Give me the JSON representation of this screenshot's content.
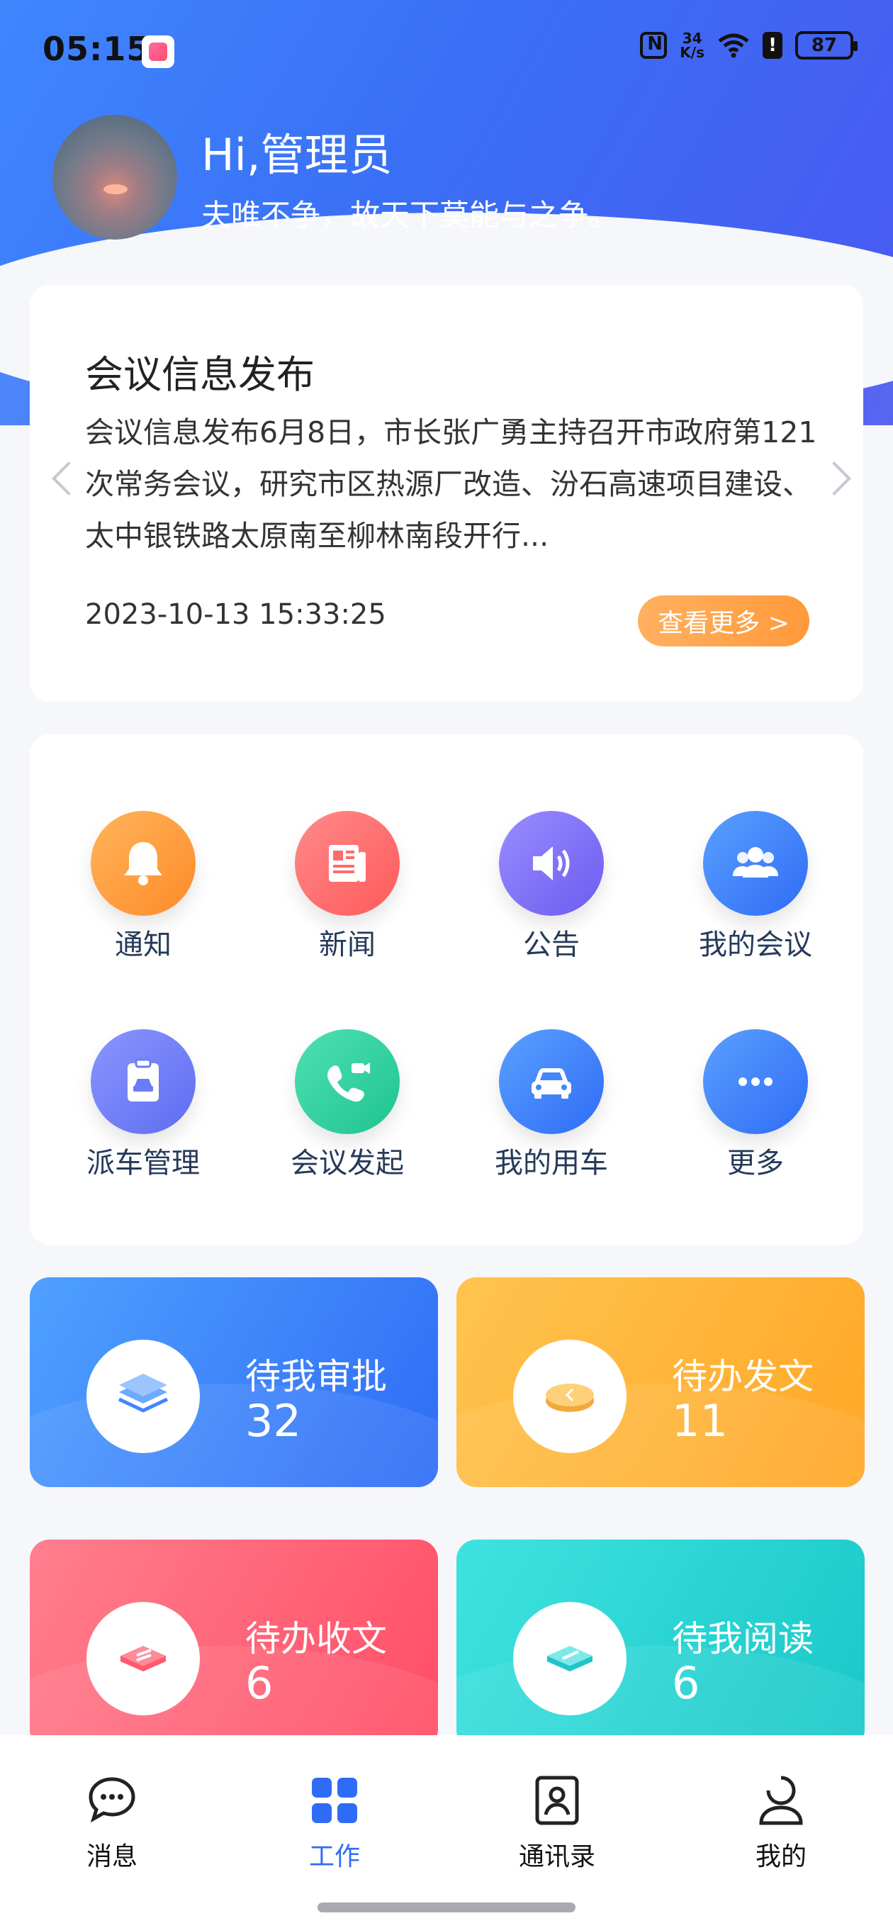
{
  "status_bar": {
    "time": "05:15",
    "net_speed_top": "34",
    "net_speed_bottom": "K/s",
    "battery": "87"
  },
  "user": {
    "greeting": "Hi,管理员",
    "motto": "夫唯不争，故天下莫能与之争。"
  },
  "notice_card": {
    "title": "会议信息发布",
    "body": "会议信息发布6月8日，市长张广勇主持召开市政府第121次常务会议，研究市区热源厂改造、汾石高速项目建设、太中银铁路太原南至柳林南段开行...",
    "datetime": "2023-10-13 15:33:25",
    "more_label": "查看更多 >"
  },
  "quick_menu": [
    {
      "label": "通知",
      "icon": "bell-icon",
      "color": "#ff9f43"
    },
    {
      "label": "新闻",
      "icon": "newspaper-icon",
      "color": "#ff6b6b"
    },
    {
      "label": "公告",
      "icon": "speaker-icon",
      "color": "#7b6cf6"
    },
    {
      "label": "我的会议",
      "icon": "group-icon",
      "color": "#3f86ff"
    },
    {
      "label": "派车管理",
      "icon": "car-clipboard-icon",
      "color": "#6c7cf7"
    },
    {
      "label": "会议发起",
      "icon": "video-call-icon",
      "color": "#2fd6a3"
    },
    {
      "label": "我的用车",
      "icon": "car-icon",
      "color": "#3f86ff"
    },
    {
      "label": "更多",
      "icon": "more-dots-icon",
      "color": "#3f86ff"
    }
  ],
  "tiles": [
    {
      "title": "待我审批",
      "count": "32",
      "icon": "layers-icon",
      "color": "#3f86ff"
    },
    {
      "title": "待办发文",
      "count": "11",
      "icon": "coin-icon",
      "color": "#ffb23a"
    },
    {
      "title": "待办收文",
      "count": "6",
      "icon": "inbox-icon",
      "color": "#ff6276"
    },
    {
      "title": "待我阅读",
      "count": "6",
      "icon": "read-icon",
      "color": "#27d6d4"
    }
  ],
  "bottom_nav": [
    {
      "label": "消息",
      "icon": "chat-icon",
      "active": false
    },
    {
      "label": "工作",
      "icon": "grid-icon",
      "active": true
    },
    {
      "label": "通讯录",
      "icon": "contacts-icon",
      "active": false
    },
    {
      "label": "我的",
      "icon": "person-icon",
      "active": false
    }
  ]
}
